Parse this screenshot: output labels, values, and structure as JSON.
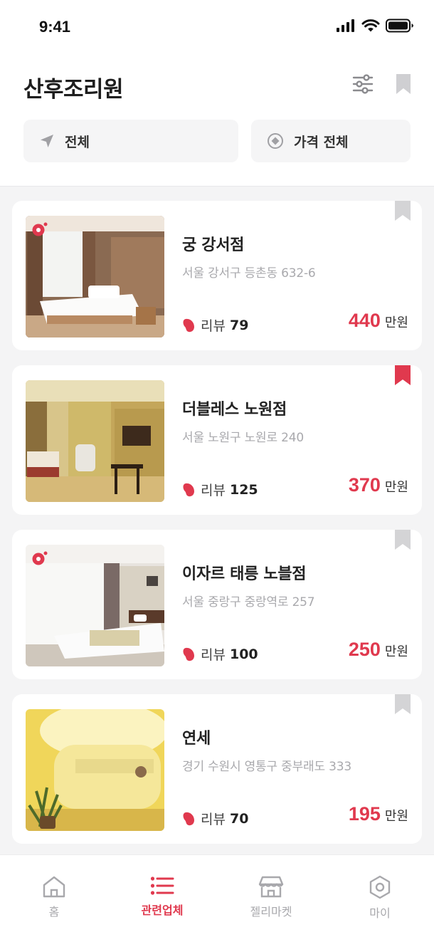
{
  "status_bar": {
    "time": "9:41"
  },
  "header": {
    "title": "산후조리원",
    "filters": [
      {
        "label": "전체",
        "icon": "location-arrow-icon"
      },
      {
        "label": "가격 전체",
        "icon": "price-target-icon"
      }
    ]
  },
  "colors": {
    "accent": "#e0394e",
    "bookmark_inactive": "#d4d4d6",
    "muted_text": "#a9a9ad"
  },
  "listings": [
    {
      "name": "궁 강서점",
      "address": "서울 강서구 등촌동 632-6",
      "review_label": "리뷰",
      "review_count": "79",
      "price": "440",
      "price_unit": "만원",
      "bookmarked": false,
      "has_badge": true
    },
    {
      "name": "더블레스 노원점",
      "address": "서울 노원구 노원로 240",
      "review_label": "리뷰",
      "review_count": "125",
      "price": "370",
      "price_unit": "만원",
      "bookmarked": true,
      "has_badge": false
    },
    {
      "name": "이자르 태릉 노블점",
      "address": "서울 중랑구 중랑역로 257",
      "review_label": "리뷰",
      "review_count": "100",
      "price": "250",
      "price_unit": "만원",
      "bookmarked": false,
      "has_badge": true
    },
    {
      "name": "연세",
      "address": "경기 수원시 영통구 중부래도 333",
      "review_label": "리뷰",
      "review_count": "70",
      "price": "195",
      "price_unit": "만원",
      "bookmarked": false,
      "has_badge": false
    }
  ],
  "tabbar": {
    "tabs": [
      {
        "label": "홈",
        "icon": "home-icon",
        "active": false
      },
      {
        "label": "관련업체",
        "icon": "list-icon",
        "active": true
      },
      {
        "label": "젤리마켓",
        "icon": "store-icon",
        "active": false
      },
      {
        "label": "마이",
        "icon": "hexagon-user-icon",
        "active": false
      }
    ]
  }
}
